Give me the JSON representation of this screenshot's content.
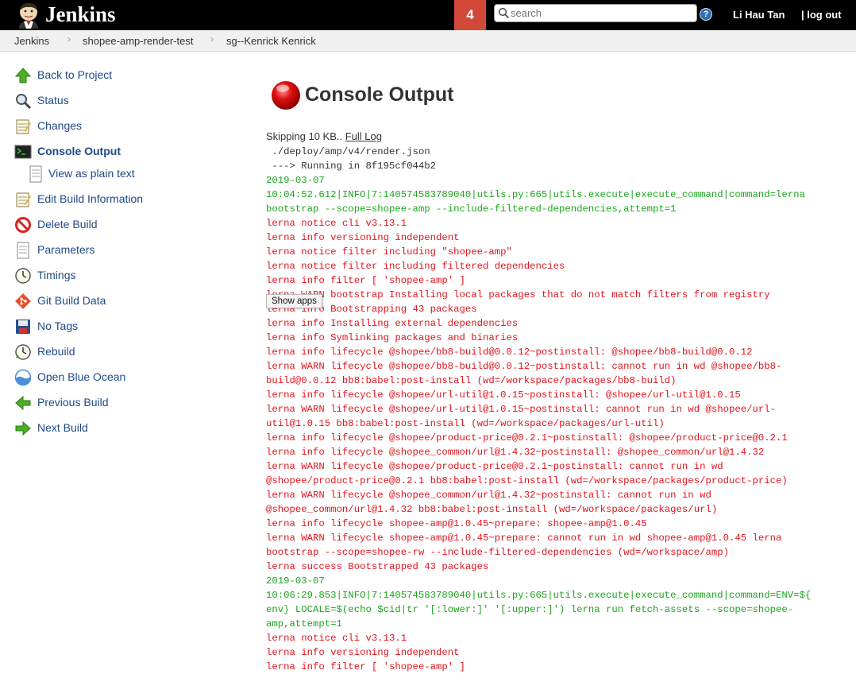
{
  "header": {
    "brand": "Jenkins",
    "notification_count": "4",
    "search_placeholder": "search",
    "help_label": "?",
    "user_name": "Li Hau Tan",
    "logout_label": "| log out"
  },
  "breadcrumb": [
    "Jenkins",
    "shopee-amp-render-test",
    "sg--Kenrick Kenrick"
  ],
  "sidebar": {
    "items": [
      {
        "label": "Back to Project",
        "icon": "up-arrow-icon"
      },
      {
        "label": "Status",
        "icon": "magnifier-icon"
      },
      {
        "label": "Changes",
        "icon": "notepad-icon"
      },
      {
        "label": "Console Output",
        "icon": "terminal-icon",
        "active": true
      },
      {
        "label": "View as plain text",
        "icon": "document-icon",
        "sub": true
      },
      {
        "label": "Edit Build Information",
        "icon": "notepad-icon"
      },
      {
        "label": "Delete Build",
        "icon": "no-entry-icon"
      },
      {
        "label": "Parameters",
        "icon": "document-icon"
      },
      {
        "label": "Timings",
        "icon": "clock-icon"
      },
      {
        "label": "Git Build Data",
        "icon": "git-icon"
      },
      {
        "label": "No Tags",
        "icon": "floppy-icon"
      },
      {
        "label": "Rebuild",
        "icon": "clock-icon"
      },
      {
        "label": "Open Blue Ocean",
        "icon": "blue-ocean-icon"
      },
      {
        "label": "Previous Build",
        "icon": "left-arrow-icon"
      },
      {
        "label": "Next Build",
        "icon": "right-arrow-icon"
      }
    ]
  },
  "main": {
    "title": "Console Output",
    "skip_text": "Skipping 10 KB.. ",
    "full_log_label": "Full Log",
    "tooltip": "Show apps",
    "lines": [
      {
        "c": "black",
        "t": " ./deploy/amp/v4/render.json"
      },
      {
        "c": "black",
        "t": " ---> Running in 8f195cf044b2"
      },
      {
        "c": "green",
        "t": "2019-03-07"
      },
      {
        "c": "green",
        "t": "10:04:52.612|INFO|7:140574583789040|utils.py:665|utils.execute|execute_command|command=lerna"
      },
      {
        "c": "green",
        "t": "bootstrap --scope=shopee-amp --include-filtered-dependencies,attempt=1"
      },
      {
        "c": "red",
        "t": "lerna notice cli v3.13.1"
      },
      {
        "c": "red",
        "t": "lerna info versioning independent"
      },
      {
        "c": "red",
        "t": "lerna notice filter including \"shopee-amp\""
      },
      {
        "c": "red",
        "t": "lerna notice filter including filtered dependencies"
      },
      {
        "c": "red",
        "t": "lerna info filter [ 'shopee-amp' ]"
      },
      {
        "c": "red",
        "t": "lerna WARN bootstrap Installing local packages that do not match filters from registry"
      },
      {
        "c": "red",
        "t": "lerna info Bootstrapping 43 packages"
      },
      {
        "c": "red",
        "t": "lerna info Installing external dependencies"
      },
      {
        "c": "red",
        "t": "lerna info Symlinking packages and binaries"
      },
      {
        "c": "red",
        "t": "lerna info lifecycle @shopee/bb8-build@0.0.12~postinstall: @shopee/bb8-build@0.0.12"
      },
      {
        "c": "red",
        "t": "lerna WARN lifecycle @shopee/bb8-build@0.0.12~postinstall: cannot run in wd @shopee/bb8-"
      },
      {
        "c": "red",
        "t": "build@0.0.12 bb8:babel:post-install (wd=/workspace/packages/bb8-build)"
      },
      {
        "c": "red",
        "t": "lerna info lifecycle @shopee/url-util@1.0.15~postinstall: @shopee/url-util@1.0.15"
      },
      {
        "c": "red",
        "t": "lerna WARN lifecycle @shopee/url-util@1.0.15~postinstall: cannot run in wd @shopee/url-"
      },
      {
        "c": "red",
        "t": "util@1.0.15 bb8:babel:post-install (wd=/workspace/packages/url-util)"
      },
      {
        "c": "red",
        "t": "lerna info lifecycle @shopee/product-price@0.2.1~postinstall: @shopee/product-price@0.2.1"
      },
      {
        "c": "red",
        "t": "lerna info lifecycle @shopee_common/url@1.4.32~postinstall: @shopee_common/url@1.4.32"
      },
      {
        "c": "red",
        "t": "lerna WARN lifecycle @shopee/product-price@0.2.1~postinstall: cannot run in wd"
      },
      {
        "c": "red",
        "t": "@shopee/product-price@0.2.1 bb8:babel:post-install (wd=/workspace/packages/product-price)"
      },
      {
        "c": "red",
        "t": "lerna WARN lifecycle @shopee_common/url@1.4.32~postinstall: cannot run in wd"
      },
      {
        "c": "red",
        "t": "@shopee_common/url@1.4.32 bb8:babel:post-install (wd=/workspace/packages/url)"
      },
      {
        "c": "red",
        "t": "lerna info lifecycle shopee-amp@1.0.45~prepare: shopee-amp@1.0.45"
      },
      {
        "c": "red",
        "t": "lerna WARN lifecycle shopee-amp@1.0.45~prepare: cannot run in wd shopee-amp@1.0.45 lerna"
      },
      {
        "c": "red",
        "t": "bootstrap --scope=shopee-rw --include-filtered-dependencies (wd=/workspace/amp)"
      },
      {
        "c": "red",
        "t": "lerna success Bootstrapped 43 packages"
      },
      {
        "c": "green",
        "t": "2019-03-07"
      },
      {
        "c": "green",
        "t": "10:06:29.853|INFO|7:140574583789040|utils.py:665|utils.execute|execute_command|command=ENV=${"
      },
      {
        "c": "green",
        "t": "env} LOCALE=$(echo $cid|tr '[:lower:]' '[:upper:]') lerna run fetch-assets --scope=shopee-"
      },
      {
        "c": "green",
        "t": "amp,attempt=1"
      },
      {
        "c": "red",
        "t": "lerna notice cli v3.13.1"
      },
      {
        "c": "red",
        "t": "lerna info versioning independent"
      },
      {
        "c": "red",
        "t": "lerna info filter [ 'shopee-amp' ]"
      }
    ]
  }
}
